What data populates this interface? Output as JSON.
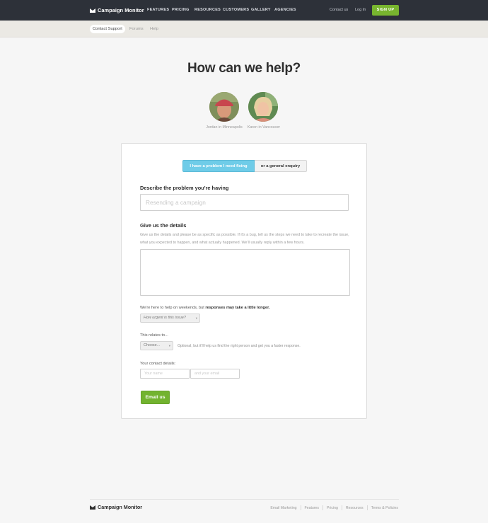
{
  "topnav": {
    "logo_text": "Campaign Monitor",
    "links": [
      "FEATURES",
      "PRICING",
      "RESOURCES",
      "CUSTOMERS",
      "GALLERY",
      "AGENCIES"
    ],
    "contact": "Contact us",
    "login": "Log In",
    "signup": "SIGN UP"
  },
  "subnav": {
    "tabs": [
      "Contact Support",
      "Forums",
      "Help"
    ],
    "active": "Contact Support"
  },
  "heading": "How can we help?",
  "agents": [
    {
      "caption": "Jordan in Minneapolis"
    },
    {
      "caption": "Karen in Vancouver"
    }
  ],
  "form": {
    "toggle_problem": "I have a problem I need fixing",
    "toggle_enquiry": "or a general enquiry",
    "active_toggle": "I have a problem I need fixing",
    "problem_label": "Describe the problem you're having",
    "problem_placeholder": "Resending a campaign",
    "details_label": "Give us the details",
    "details_help": "Give us the details and please be as specific as possible. If it's a bug, tell us the steps we need to take to recreate the issue, what you expected to happen, and what actually happened. We'll usually reply within a few hours.",
    "weekend_note": "We're here to help on weekends, but",
    "weekend_note_bold": "responses may take a little longer.",
    "urgency_select": "How urgent is this issue?",
    "relates_label": "This relates to...",
    "relates_select": "Choose...",
    "relates_hint": "Optional, but it'll help us find the right person and get you a faster response.",
    "contact_label": "Your contact details:",
    "name_placeholder": "Your name",
    "email_placeholder": "and your email",
    "submit": "Email us"
  },
  "footer": {
    "logo_text": "Campaign Monitor",
    "links": [
      "Email Marketing",
      "Features",
      "Pricing",
      "Resources",
      "Terms & Policies"
    ]
  },
  "colors": {
    "nav_bg": "#2d3139",
    "subnav_bg": "#ebe9e4",
    "accent_green": "#78b52f",
    "toggle_blue": "#6fcce8"
  }
}
